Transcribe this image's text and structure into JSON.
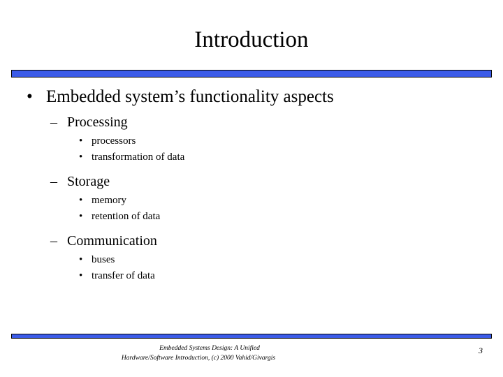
{
  "slide": {
    "title": "Introduction",
    "page_number": "3",
    "accent_color": "#3b5be8",
    "border_color": "#000000",
    "text_color": "#000000",
    "background_color": "#ffffff"
  },
  "icons": {
    "bullet_round": "•",
    "dash": "–"
  },
  "outline": {
    "level1": "Embedded system’s functionality aspects",
    "groups": [
      {
        "heading": "Processing",
        "items": [
          "processors",
          "transformation of data"
        ]
      },
      {
        "heading": "Storage",
        "items": [
          "memory",
          "retention of data"
        ]
      },
      {
        "heading": "Communication",
        "items": [
          "buses",
          "transfer of data"
        ]
      }
    ]
  },
  "footer": {
    "line1": "Embedded Systems Design: A Unified",
    "line2": "Hardware/Software Introduction, (c) 2000 Vahid/Givargis"
  }
}
